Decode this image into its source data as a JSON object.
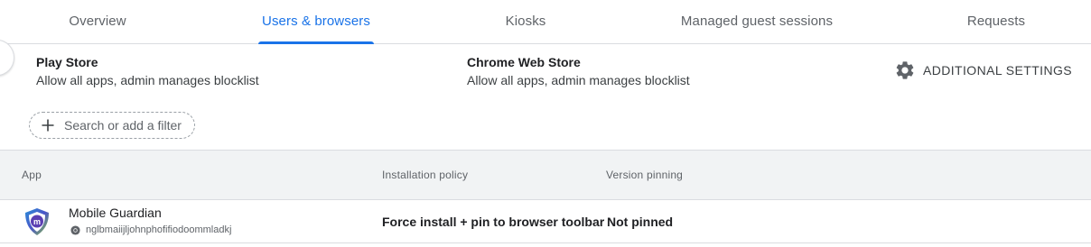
{
  "tabs": [
    {
      "label": "Overview"
    },
    {
      "label": "Users & browsers"
    },
    {
      "label": "Kiosks"
    },
    {
      "label": "Managed guest sessions"
    },
    {
      "label": "Requests"
    }
  ],
  "active_tab": "Users & browsers",
  "accent_color": "#1a73e8",
  "stores": {
    "play": {
      "title": "Play Store",
      "desc": "Allow all apps, admin manages blocklist"
    },
    "chrome": {
      "title": "Chrome Web Store",
      "desc": "Allow all apps, admin manages blocklist"
    }
  },
  "settings_button": {
    "label": "ADDITIONAL SETTINGS",
    "icon": "gear-icon"
  },
  "filter": {
    "placeholder": "Search or add a filter",
    "icon": "plus-icon"
  },
  "table": {
    "columns": [
      "App",
      "Installation policy",
      "Version pinning"
    ],
    "rows": [
      {
        "app_name": "Mobile Guardian",
        "app_id": "nglbmaiijljohnphofifiodoommladkj",
        "installation_policy": "Force install + pin to browser toolbar",
        "version_pinning": "Not pinned"
      }
    ]
  }
}
